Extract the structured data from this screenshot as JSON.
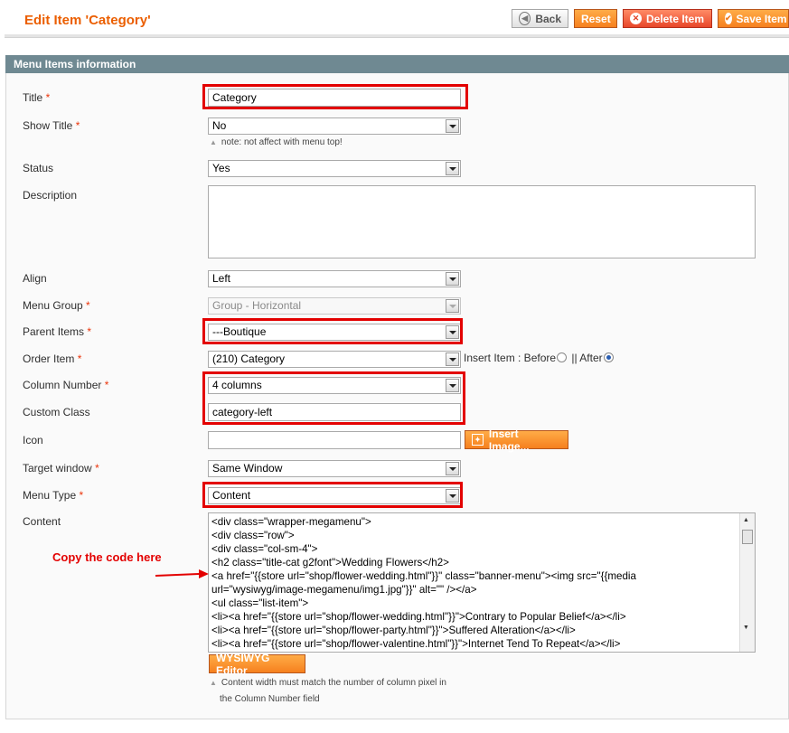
{
  "header": {
    "title": "Edit Item 'Category'",
    "back_label": "Back",
    "reset_label": "Reset",
    "delete_label": "Delete Item",
    "save_label": "Save Item"
  },
  "fieldset": {
    "title": "Menu Items information"
  },
  "form": {
    "title": {
      "label": "Title",
      "value": "Category"
    },
    "show_title": {
      "label": "Show Title",
      "value": "No",
      "note": "note: not affect with menu top!"
    },
    "status": {
      "label": "Status",
      "value": "Yes"
    },
    "description": {
      "label": "Description",
      "value": ""
    },
    "align": {
      "label": "Align",
      "value": "Left"
    },
    "menu_group": {
      "label": "Menu Group",
      "value": "Group - Horizontal"
    },
    "parent_items": {
      "label": "Parent Items",
      "value": "---Boutique"
    },
    "order_item": {
      "label": "Order Item",
      "value": "(210) Category",
      "insert_label": "Insert Item : Before",
      "after_label": "|| After"
    },
    "column_number": {
      "label": "Column Number",
      "value": "4 columns"
    },
    "custom_class": {
      "label": "Custom Class",
      "value": "category-left"
    },
    "icon": {
      "label": "Icon",
      "value": "",
      "button_label": "Insert Image..."
    },
    "target_window": {
      "label": "Target window",
      "value": "Same Window"
    },
    "menu_type": {
      "label": "Menu Type",
      "value": "Content"
    },
    "content": {
      "label": "Content",
      "lines": [
        "<div class=\"wrapper-megamenu\">",
        "<div class=\"row\">",
        "<div class=\"col-sm-4\">",
        "<h2 class=\"title-cat g2font\">Wedding Flowers</h2>",
        "<a href=\"{{store url=\"shop/flower-wedding.html\"}}\" class=\"banner-menu\"><img src=\"{{media",
        "url=\"wysiwyg/image-megamenu/img1.jpg\"}}\" alt=\"\" /></a>",
        "<ul class=\"list-item\">",
        "<li><a href=\"{{store url=\"shop/flower-wedding.html\"}}\">Contrary to Popular Belief</a></li>",
        "<li><a href=\"{{store url=\"shop/flower-party.html\"}}\">Suffered Alteration</a></li>",
        "<li><a href=\"{{store url=\"shop/flower-valentine.html\"}}\">Internet Tend To Repeat</a></li>"
      ],
      "editor_button": "WYSIWYG Editor",
      "note_line1": "Content width must match the number of column pixel in",
      "note_line2": "the Column Number field"
    }
  },
  "annotation": {
    "text": "Copy the code here",
    "color": "#e30000"
  },
  "colors": {
    "accent": "#eb5e00",
    "highlight": "#e30000",
    "section_header": "#6f8992"
  }
}
